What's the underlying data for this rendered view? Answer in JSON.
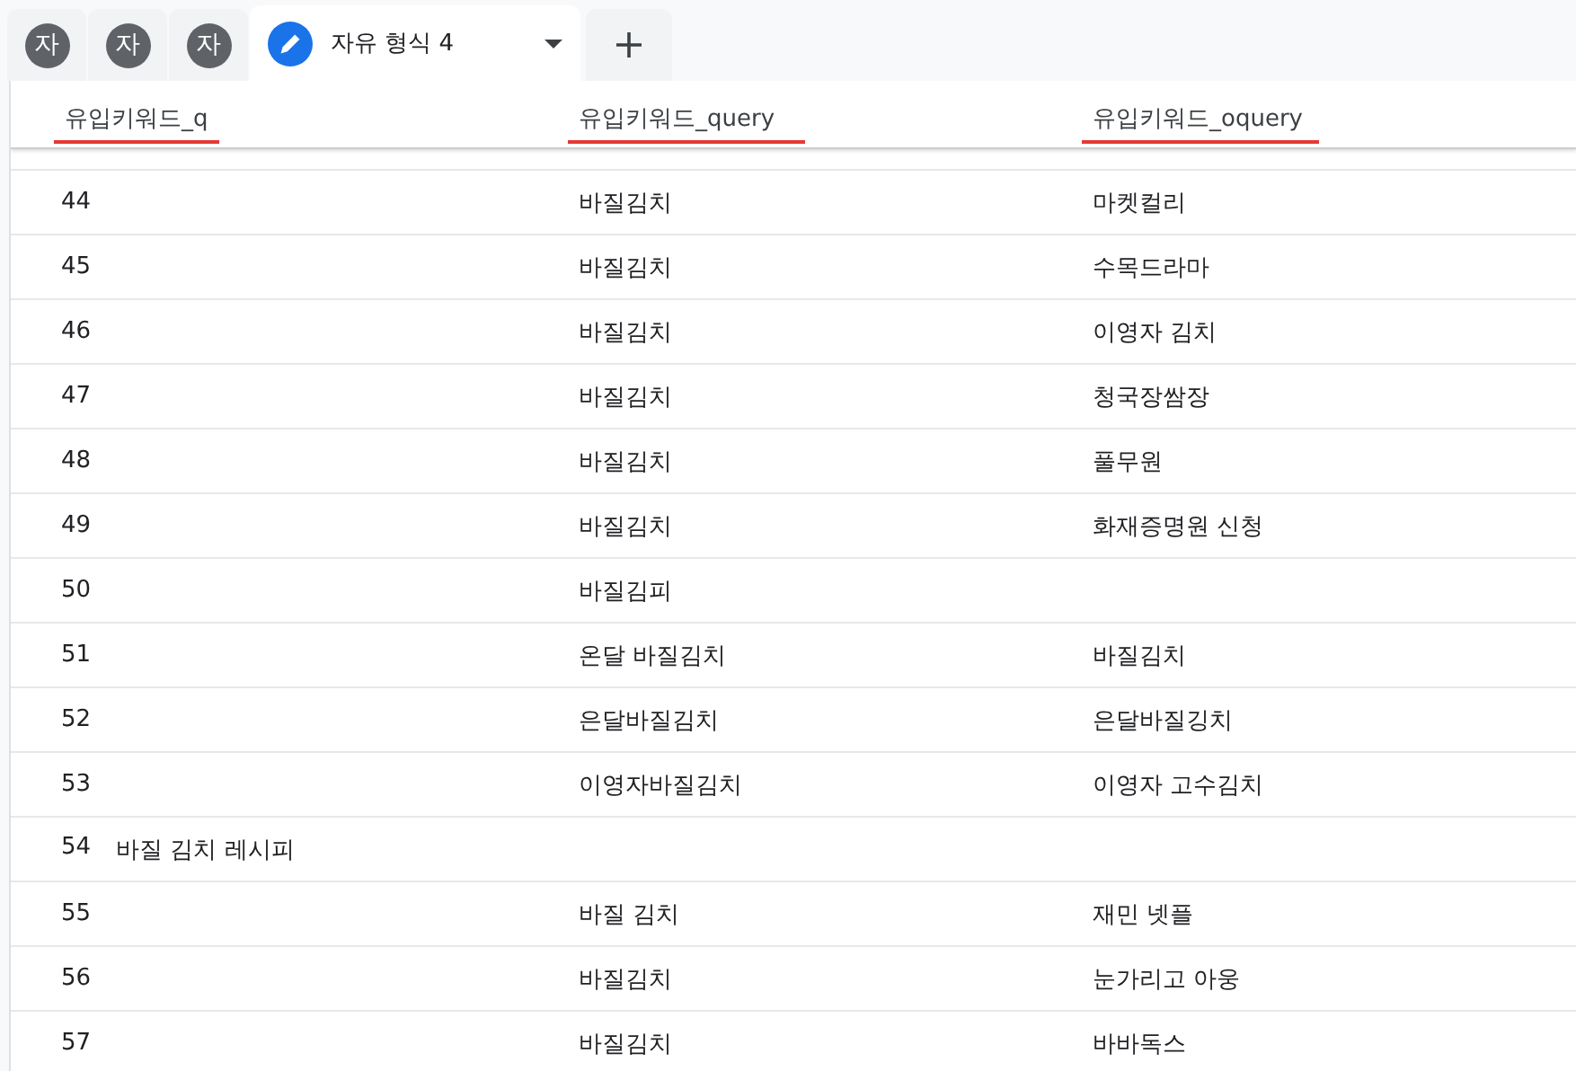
{
  "tabs": [
    {
      "kind": "avatar",
      "label": "자",
      "selected": false
    },
    {
      "kind": "avatar",
      "label": "자",
      "selected": false
    },
    {
      "kind": "avatar",
      "label": "자",
      "selected": false
    },
    {
      "kind": "editor",
      "label": "자유 형식 4",
      "selected": true
    }
  ],
  "table": {
    "columns": [
      "유입키워드_q",
      "유입키워드_query",
      "유입키워드_oquery"
    ],
    "rows": [
      {
        "index": "44",
        "query": "바질김치",
        "oquery": "마켓컬리"
      },
      {
        "index": "45",
        "query": "바질김치",
        "oquery": "수목드라마"
      },
      {
        "index": "46",
        "query": "바질김치",
        "oquery": "이영자 김치"
      },
      {
        "index": "47",
        "query": "바질김치",
        "oquery": "청국장쌈장"
      },
      {
        "index": "48",
        "query": "바질김치",
        "oquery": "풀무원"
      },
      {
        "index": "49",
        "query": "바질김치",
        "oquery": "화재증명원 신청"
      },
      {
        "index": "50",
        "query": "바질김피"
      },
      {
        "index": "51",
        "query": "온달 바질김치",
        "oquery": "바질김치"
      },
      {
        "index": "52",
        "query": "은달바질김치",
        "oquery": "은달바질깅치"
      },
      {
        "index": "53",
        "query": "이영자바질김치",
        "oquery": "이영자 고수김치"
      },
      {
        "index": "54",
        "q": "바질 김치 레시피"
      },
      {
        "index": "55",
        "query": "바질 김치",
        "oquery": "재민 넷플"
      },
      {
        "index": "56",
        "query": "바질김치",
        "oquery": "눈가리고 아웅"
      },
      {
        "index": "57",
        "query": "바질김치",
        "oquery": "바바독스"
      }
    ]
  }
}
